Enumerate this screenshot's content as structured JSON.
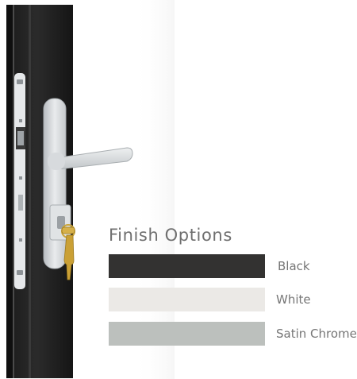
{
  "title": "Finish Options",
  "finishes": [
    {
      "label": "Black",
      "color": "#333231"
    },
    {
      "label": "White",
      "color": "#ebe9e6"
    },
    {
      "label": "Satin Chrome",
      "color": "#bcc0bd"
    }
  ],
  "icons": {
    "product": "door-handle-with-key"
  }
}
